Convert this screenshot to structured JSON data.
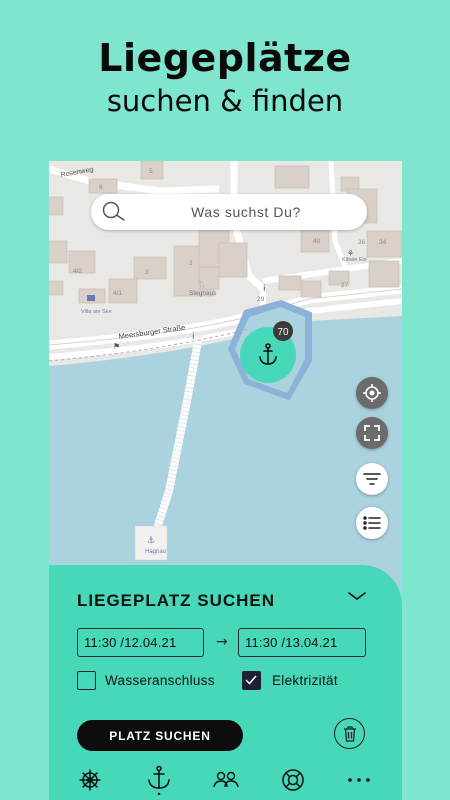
{
  "headline": {
    "line1": "Liegeplätze",
    "line2": "suchen & finden"
  },
  "search": {
    "placeholder": "Was suchst Du?"
  },
  "map": {
    "streets": [
      "Rosenweg",
      "Meersburger Straße"
    ],
    "house_numbers": [
      "5",
      "6",
      "2",
      "4/2",
      "3",
      "4/1",
      "40",
      "36",
      "34",
      "27",
      "29"
    ],
    "pois": [
      "Steghaus",
      "Villa am See",
      "Kibele Eis",
      "Hagnau"
    ],
    "marina_count": "70"
  },
  "icons": {
    "search": "search-icon",
    "locate": "crosshair-icon",
    "fullscreen": "fullscreen-icon",
    "filter": "filter-icon",
    "list": "list-icon",
    "anchor": "anchor-icon",
    "collapse": "chevron-down-icon",
    "trash": "trash-icon"
  },
  "sheet": {
    "title": "LIEGEPLATZ SUCHEN",
    "from_value": "11:30 /12.04.21",
    "to_value": "11:30 /13.04.21",
    "arrow": "→",
    "water_label": "Wasseranschluss",
    "water_checked": false,
    "electricity_label": "Elektrizität",
    "electricity_checked": true,
    "search_button": "PLATZ SUCHEN"
  },
  "nav": {
    "items": [
      "helm-icon",
      "anchor-icon",
      "people-icon",
      "lifebuoy-icon",
      "more-icon"
    ],
    "active": "anchor-icon"
  },
  "colors": {
    "background": "#7ee5cf",
    "accent": "#46d8b8",
    "water": "#aad3df",
    "button": "#0c0c0c"
  }
}
